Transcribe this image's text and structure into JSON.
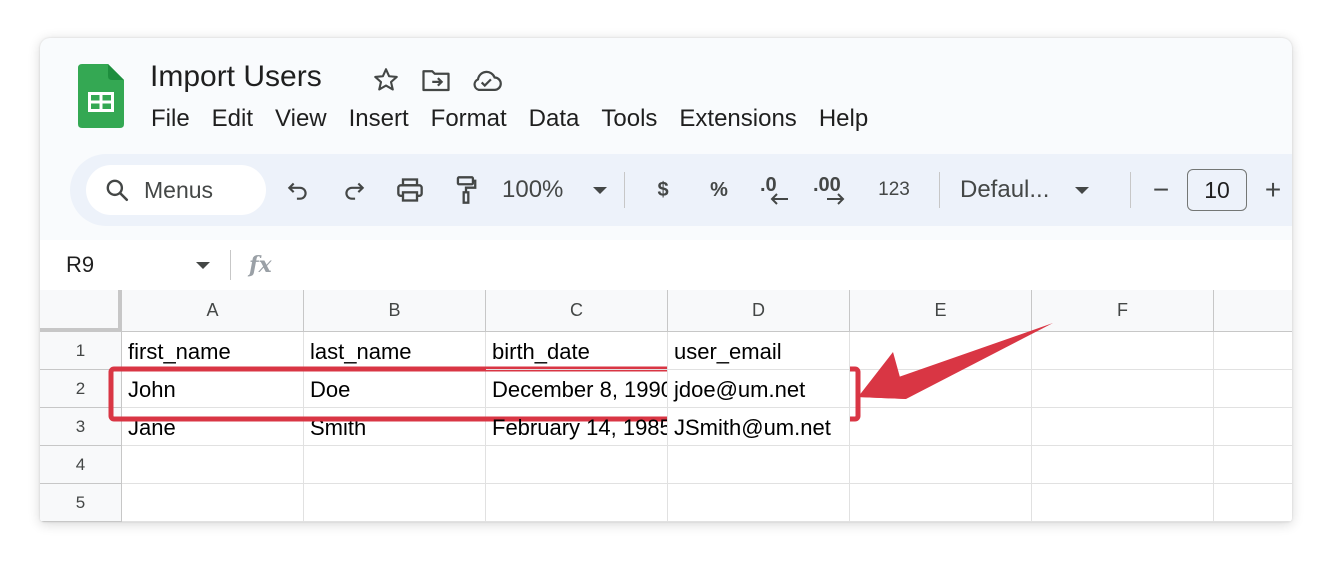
{
  "document": {
    "title": "Import Users"
  },
  "menu": [
    "File",
    "Edit",
    "View",
    "Insert",
    "Format",
    "Data",
    "Tools",
    "Extensions",
    "Help"
  ],
  "toolbar": {
    "search_label": "Menus",
    "zoom": "100%",
    "currency": "$",
    "percent": "%",
    "decrease_decimal": ".0",
    "increase_decimal": ".00",
    "number_format": "123",
    "font": "Defaul...",
    "font_size": "10",
    "minus": "−",
    "plus": "+"
  },
  "formula_bar": {
    "cell_ref": "R9",
    "fx": "fx"
  },
  "grid": {
    "columns": [
      "A",
      "B",
      "C",
      "D",
      "E",
      "F"
    ],
    "rows": [
      "1",
      "2",
      "3",
      "4",
      "5"
    ],
    "cells": [
      [
        "first_name",
        "last_name",
        "birth_date",
        "user_email",
        "",
        ""
      ],
      [
        "John",
        "Doe",
        "December 8, 1990",
        "jdoe@um.net",
        "",
        ""
      ],
      [
        "Jane",
        "Smith",
        "February 14, 1985",
        "JSmith@um.net",
        "",
        ""
      ],
      [
        "",
        "",
        "",
        "",
        "",
        ""
      ],
      [
        "",
        "",
        "",
        "",
        "",
        ""
      ]
    ]
  },
  "colors": {
    "annotation": "#d93644",
    "sheets_green": "#34a853"
  }
}
